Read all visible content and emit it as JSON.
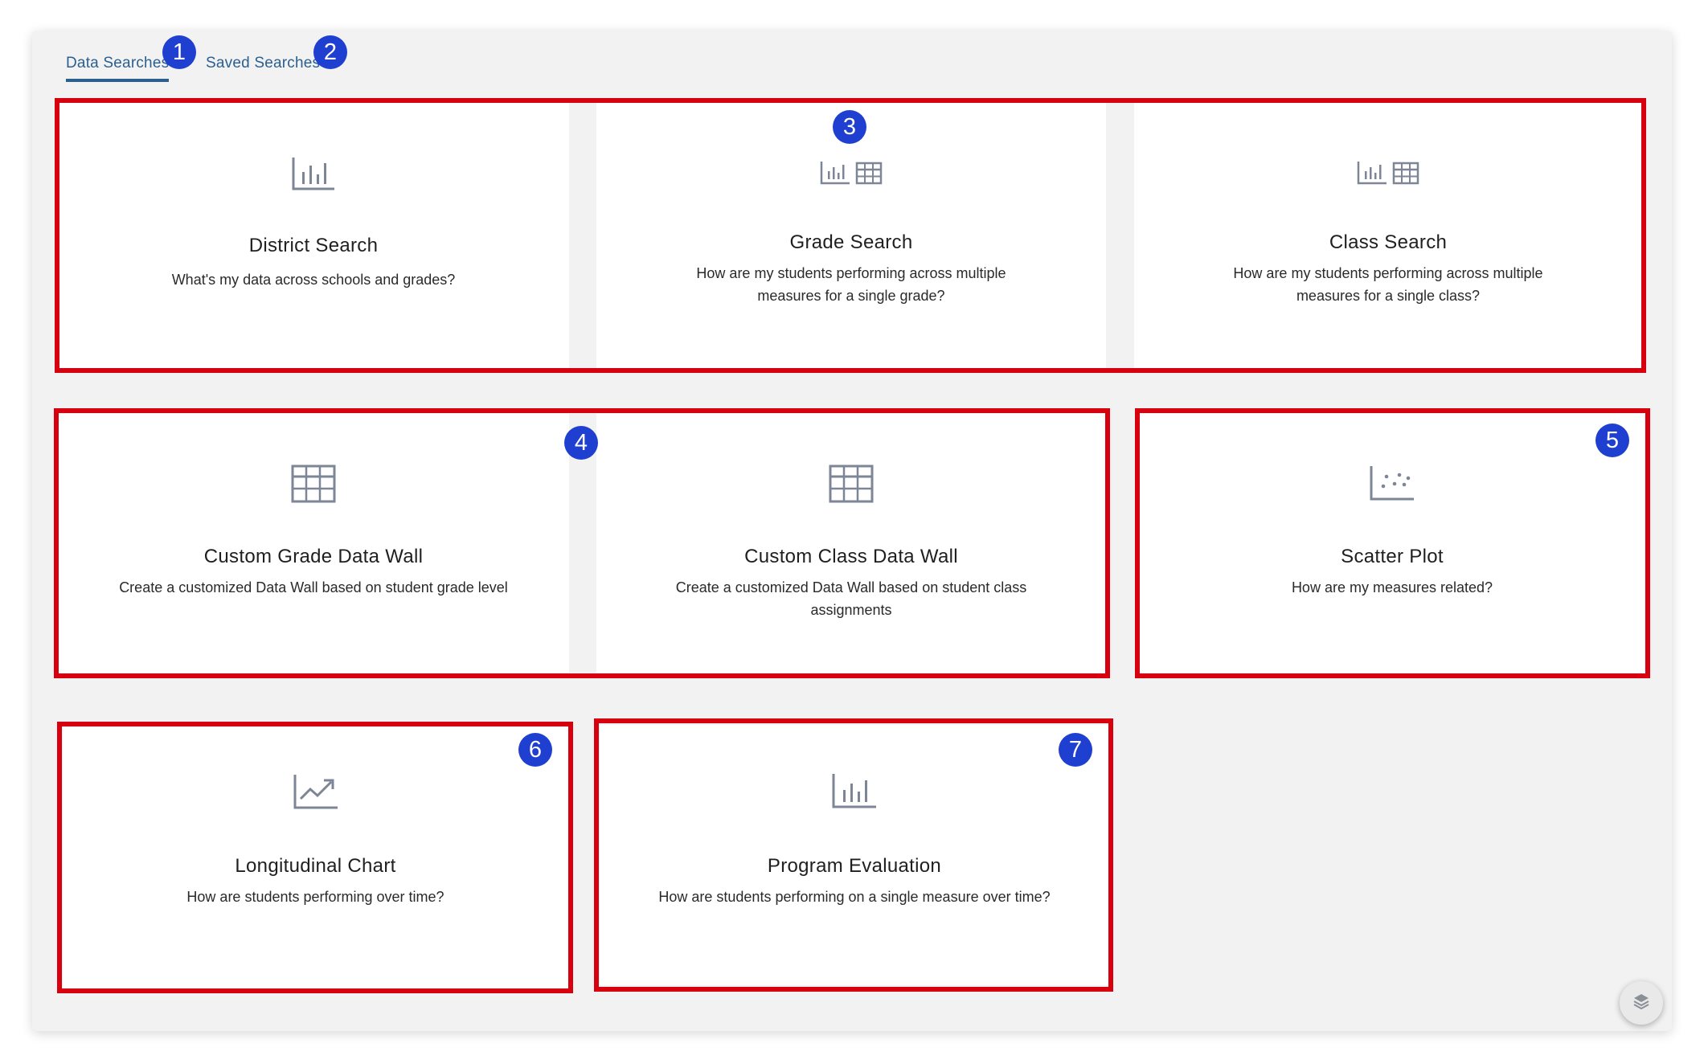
{
  "tabs": {
    "data_searches": "Data Searches",
    "saved_searches": "Saved Searches"
  },
  "cards": [
    {
      "title": "District Search",
      "desc": "What's my data across schools and grades?",
      "icon": "bar-chart-icon"
    },
    {
      "title": "Grade Search",
      "desc": "How are my students performing across multiple measures for a single grade?",
      "icon": "bar-chart-and-table-icon"
    },
    {
      "title": "Class Search",
      "desc": "How are my students performing across multiple measures for a single class?",
      "icon": "bar-chart-and-table-icon"
    },
    {
      "title": "Custom Grade Data Wall",
      "desc": "Create a customized Data Wall based on student grade level",
      "icon": "table-icon"
    },
    {
      "title": "Custom Class Data Wall",
      "desc": "Create a customized Data Wall based on student class assignments",
      "icon": "table-icon"
    },
    {
      "title": "Scatter Plot",
      "desc": "How are my measures related?",
      "icon": "scatter-plot-icon"
    },
    {
      "title": "Longitudinal Chart",
      "desc": "How are students performing over time?",
      "icon": "trend-chart-icon"
    },
    {
      "title": "Program Evaluation",
      "desc": "How are students performing on a single measure over time?",
      "icon": "bar-chart-icon"
    }
  ],
  "markers": [
    "1",
    "2",
    "3",
    "4",
    "5",
    "6",
    "7"
  ],
  "colors": {
    "accent": "#2b5f8f",
    "annotation_red": "#d6000f",
    "marker_blue": "#1f3fd1",
    "icon_gray": "#7d8696"
  },
  "floating_button_icon": "layers-icon"
}
